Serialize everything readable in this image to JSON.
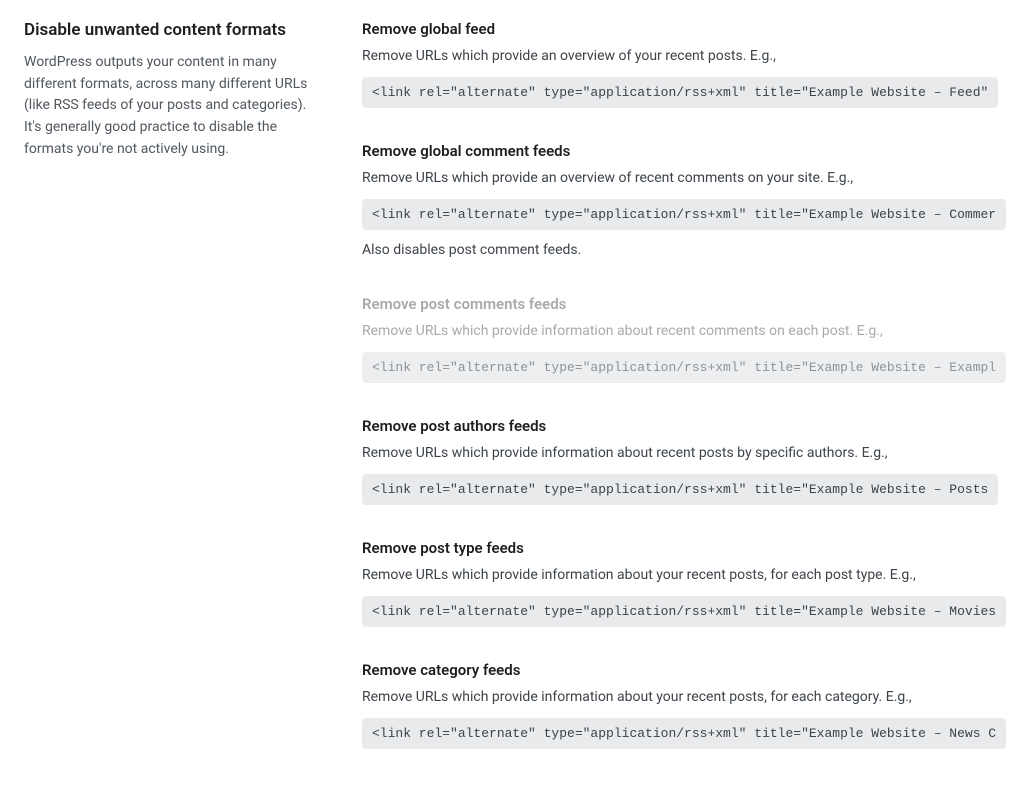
{
  "sidebar": {
    "title": "Disable unwanted content formats",
    "desc": "WordPress outputs your content in many different formats, across many different URLs (like RSS feeds of your posts and categories). It's generally good practice to disable the formats you're not actively using."
  },
  "settings": [
    {
      "key": "global-feed",
      "title": "Remove global feed",
      "desc": "Remove URLs which provide an overview of your recent posts. E.g.,",
      "code": "<link rel=\"alternate\" type=\"application/rss+xml\" title=\"Example Website – Feed\"",
      "on": false,
      "locked": false,
      "extra": ""
    },
    {
      "key": "global-comment-feeds",
      "title": "Remove global comment feeds",
      "desc": "Remove URLs which provide an overview of recent comments on your site. E.g.,",
      "code": "<link rel=\"alternate\" type=\"application/rss+xml\" title=\"Example Website – Commer",
      "on": true,
      "locked": false,
      "extra": "Also disables post comment feeds."
    },
    {
      "key": "post-comments-feeds",
      "title": "Remove post comments feeds",
      "desc": "Remove URLs which provide information about recent comments on each post. E.g.,",
      "code": "<link rel=\"alternate\" type=\"application/rss+xml\" title=\"Example Website – Exampl",
      "on": true,
      "locked": true,
      "extra": ""
    },
    {
      "key": "post-authors-feeds",
      "title": "Remove post authors feeds",
      "desc": "Remove URLs which provide information about recent posts by specific authors. E.g.,",
      "code": "<link rel=\"alternate\" type=\"application/rss+xml\" title=\"Example Website – Posts ",
      "on": true,
      "locked": false,
      "extra": ""
    },
    {
      "key": "post-type-feeds",
      "title": "Remove post type feeds",
      "desc": "Remove URLs which provide information about your recent posts, for each post type. E.g.,",
      "code": "<link rel=\"alternate\" type=\"application/rss+xml\" title=\"Example Website – Movies",
      "on": true,
      "locked": false,
      "extra": ""
    },
    {
      "key": "category-feeds",
      "title": "Remove category feeds",
      "desc": "Remove URLs which provide information about your recent posts, for each category. E.g.,",
      "code": "<link rel=\"alternate\" type=\"application/rss+xml\" title=\"Example Website – News C",
      "on": true,
      "locked": false,
      "extra": ""
    }
  ]
}
